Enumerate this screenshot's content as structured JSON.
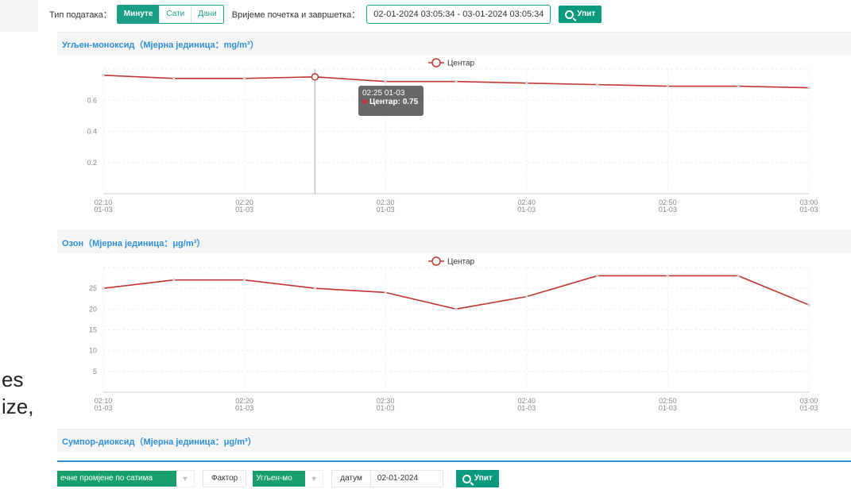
{
  "toolbar": {
    "type_label": "Тип података：",
    "types": [
      "Минуте",
      "Сати",
      "Дани"
    ],
    "active_type": "Минуте",
    "time_label": "Вријеме почетка и завршетка：",
    "date_range": "02-01-2024 03:05:34 - 03-01-2024 03:05:34",
    "query_label": "Упит"
  },
  "background_text": {
    "line1": "es",
    "line2": "ize,"
  },
  "colors": {
    "series": "#c23531",
    "accent": "#1a9e86",
    "title": "#2e8fd6"
  },
  "tooltip": {
    "title": "02:25 01-03",
    "series": "Центар",
    "value": "0.75"
  },
  "panels": [
    {
      "title": "Угљен-моноксид（Мјерна јединица：mg/m³）"
    },
    {
      "title": "Озон（Мјерна јединица：μg/m³）"
    },
    {
      "title": "Сумпор-диоксид（Мјерна јединица：μg/m³）"
    }
  ],
  "chart_data": [
    {
      "type": "line",
      "title": "Угљен-моноксид（Мјерна јединица：mg/m³）",
      "x": [
        "02:10 01-03",
        "02:15 01-03",
        "02:20 01-03",
        "02:25 01-03",
        "02:30 01-03",
        "02:35 01-03",
        "02:40 01-03",
        "02:45 01-03",
        "02:50 01-03",
        "02:55 01-03",
        "03:00 01-03"
      ],
      "x_ticks": [
        "02:10 01-03",
        "02:20 01-03",
        "02:30 01-03",
        "02:40 01-03",
        "02:50 01-03",
        "03:00 01-03"
      ],
      "series": [
        {
          "name": "Центар",
          "values": [
            0.76,
            0.74,
            0.74,
            0.75,
            0.72,
            0.72,
            0.71,
            0.7,
            0.69,
            0.69,
            0.68
          ]
        }
      ],
      "yticks": [
        0.2,
        0.4,
        0.6
      ],
      "ylim": [
        0,
        0.8
      ],
      "legend": "top-center",
      "grid": true
    },
    {
      "type": "line",
      "title": "Озон（Мјерна јединица：μg/m³）",
      "x": [
        "02:10 01-03",
        "02:15 01-03",
        "02:20 01-03",
        "02:25 01-03",
        "02:30 01-03",
        "02:35 01-03",
        "02:40 01-03",
        "02:45 01-03",
        "02:50 01-03",
        "02:55 01-03",
        "03:00 01-03"
      ],
      "x_ticks": [
        "02:10 01-03",
        "02:20 01-03",
        "02:30 01-03",
        "02:40 01-03",
        "02:50 01-03",
        "03:00 01-03"
      ],
      "series": [
        {
          "name": "Центар",
          "values": [
            25,
            27,
            27,
            25,
            24,
            20,
            23,
            28,
            28,
            28,
            21
          ]
        }
      ],
      "yticks": [
        5,
        10,
        15,
        20,
        25
      ],
      "ylim": [
        0,
        30
      ],
      "legend": "top-center",
      "grid": true
    }
  ],
  "bottombar": {
    "select1": "ечне промјене по сатима",
    "factor_label": "Фактор",
    "factor_value": "Угљен-мо",
    "date_label": "датум",
    "date_value": "02-01-2024",
    "query_label": "Упит"
  }
}
